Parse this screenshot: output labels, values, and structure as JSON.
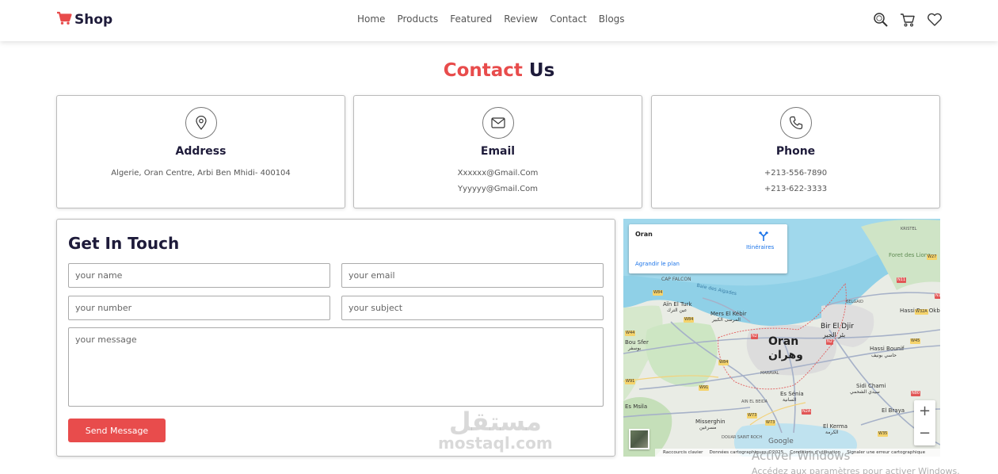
{
  "header": {
    "logo_text": "Shop",
    "nav": [
      "Home",
      "Products",
      "Featured",
      "Review",
      "Contact",
      "Blogs"
    ],
    "icons": [
      "search-icon",
      "cart-icon",
      "heart-icon"
    ]
  },
  "section": {
    "title_accent": "Contact",
    "title_main": "Us"
  },
  "cards": [
    {
      "title": "Address",
      "icon": "map-pin-icon",
      "lines": [
        "Algerie, Oran Centre, Arbi Ben Mhidi- 400104"
      ]
    },
    {
      "title": "Email",
      "icon": "envelope-icon",
      "lines": [
        "Xxxxxx@Gmail.Com",
        "Yyyyyy@Gmail.Com"
      ]
    },
    {
      "title": "Phone",
      "icon": "phone-icon",
      "lines": [
        "+213-556-7890",
        "+213-622-3333"
      ]
    }
  ],
  "form": {
    "title": "Get In Touch",
    "name_placeholder": "your name",
    "email_placeholder": "your email",
    "number_placeholder": "your number",
    "subject_placeholder": "your subject",
    "message_placeholder": "your message",
    "submit_label": "Send Message"
  },
  "map": {
    "place_name": "Oran",
    "directions_label": "Itinéraires",
    "enlarge_label": "Agrandir le plan",
    "city_label_latin": "Oran",
    "city_label_arabic": "وهران",
    "labels": {
      "cap_falcon": "CAP FALCON",
      "ain_el_turk": "Aïn El Turk",
      "ain_el_turk_ar": "عين الترك",
      "mers_el_kebir": "Mers El Kébir",
      "mers_el_kebir_ar": "المرسى الكبير",
      "bir_el_djir": "Bir El Djir",
      "bir_el_djir_ar": "بئر الجير",
      "bou_sfer": "Bou Sfer",
      "bou_sfer_ar": "بوسفر",
      "hassi_bounif": "Hassi Bounif",
      "hassi_bounif_ar": "حاسي بونيف",
      "hassi_ben_okba": "Hassi Ben Okba",
      "fort_des_lions": "Foret des Lions",
      "kristel": "KRISTEL",
      "belgaid": "BELGAID",
      "sidi_chami": "Sidi Chami",
      "sidi_chami_ar": "سيدي الشحمي",
      "es_senia": "Es Sénia",
      "es_senia_ar": "السانية",
      "el_kerma": "El Kerma",
      "el_kerma_ar": "الكرمة",
      "el_braya": "El Braya",
      "misserghin": "Misserghin",
      "misserghin_ar": "مسرغين",
      "ain_el_beida": "AIN EL BEIDA",
      "maraval": "MARAVAL",
      "es_msila": "Es Msila",
      "douar_saint_roch": "DOUAR SAINT ROCH",
      "bay": "Baie des Aigades"
    },
    "road_labels": [
      "W84",
      "W84",
      "W44",
      "N2",
      "N2",
      "W84",
      "W91",
      "W91",
      "W73",
      "N2A",
      "N11",
      "W27",
      "W32A",
      "W45",
      "N80",
      "W35",
      "W73",
      "N11"
    ],
    "footer": [
      "Raccourcis clavier",
      "Données cartographiques ©2025",
      "Conditions d'utilisation",
      "Signaler une erreur cartographique"
    ],
    "google_label": "Google",
    "zoom_in": "+",
    "zoom_out": "−"
  },
  "watermark": {
    "arabic": "مستقل",
    "latin": "mostaql.com"
  },
  "windows": {
    "activate": "Activer Windows",
    "sub": "Accédez aux paramètres pour activer Windows."
  },
  "colors": {
    "accent": "#e84c4c",
    "navy": "#1e1b3a"
  }
}
